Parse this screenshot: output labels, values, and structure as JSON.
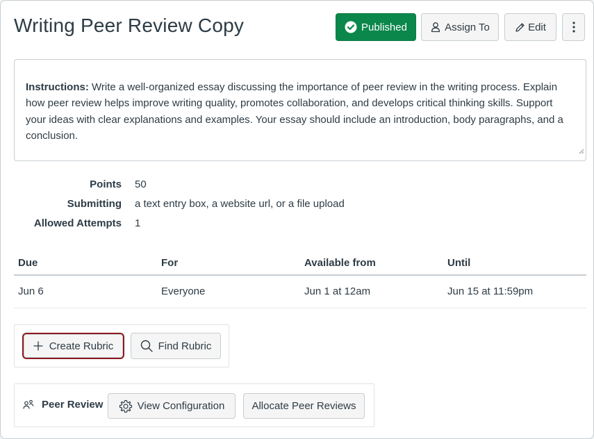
{
  "header": {
    "title": "Writing Peer Review Copy",
    "published_label": "Published",
    "assign_label": "Assign To",
    "edit_label": "Edit"
  },
  "instructions": {
    "label": "Instructions:",
    "text": " Write a well-organized essay discussing the importance of peer review in the writing process. Explain how peer review helps improve writing quality, promotes collaboration, and develops critical thinking skills. Support your ideas with clear explanations and examples. Your essay should include an introduction, body paragraphs, and a conclusion."
  },
  "details": [
    {
      "label": "Points",
      "value": "50"
    },
    {
      "label": "Submitting",
      "value": "a text entry box, a website url, or a file upload"
    },
    {
      "label": "Allowed Attempts",
      "value": "1"
    }
  ],
  "dates_table": {
    "headers": [
      "Due",
      "For",
      "Available from",
      "Until"
    ],
    "rows": [
      [
        "Jun 6",
        "Everyone",
        "Jun 1 at 12am",
        "Jun 15 at 11:59pm"
      ]
    ]
  },
  "rubric": {
    "create_label": "Create Rubric",
    "find_label": "Find Rubric"
  },
  "peer_review": {
    "label": "Peer Review",
    "view_config_label": "View Configuration",
    "allocate_label": "Allocate Peer Reviews"
  },
  "colors": {
    "published_green": "#0b874b",
    "focus_ring": "#8b1a1f",
    "text": "#2d3b45"
  }
}
